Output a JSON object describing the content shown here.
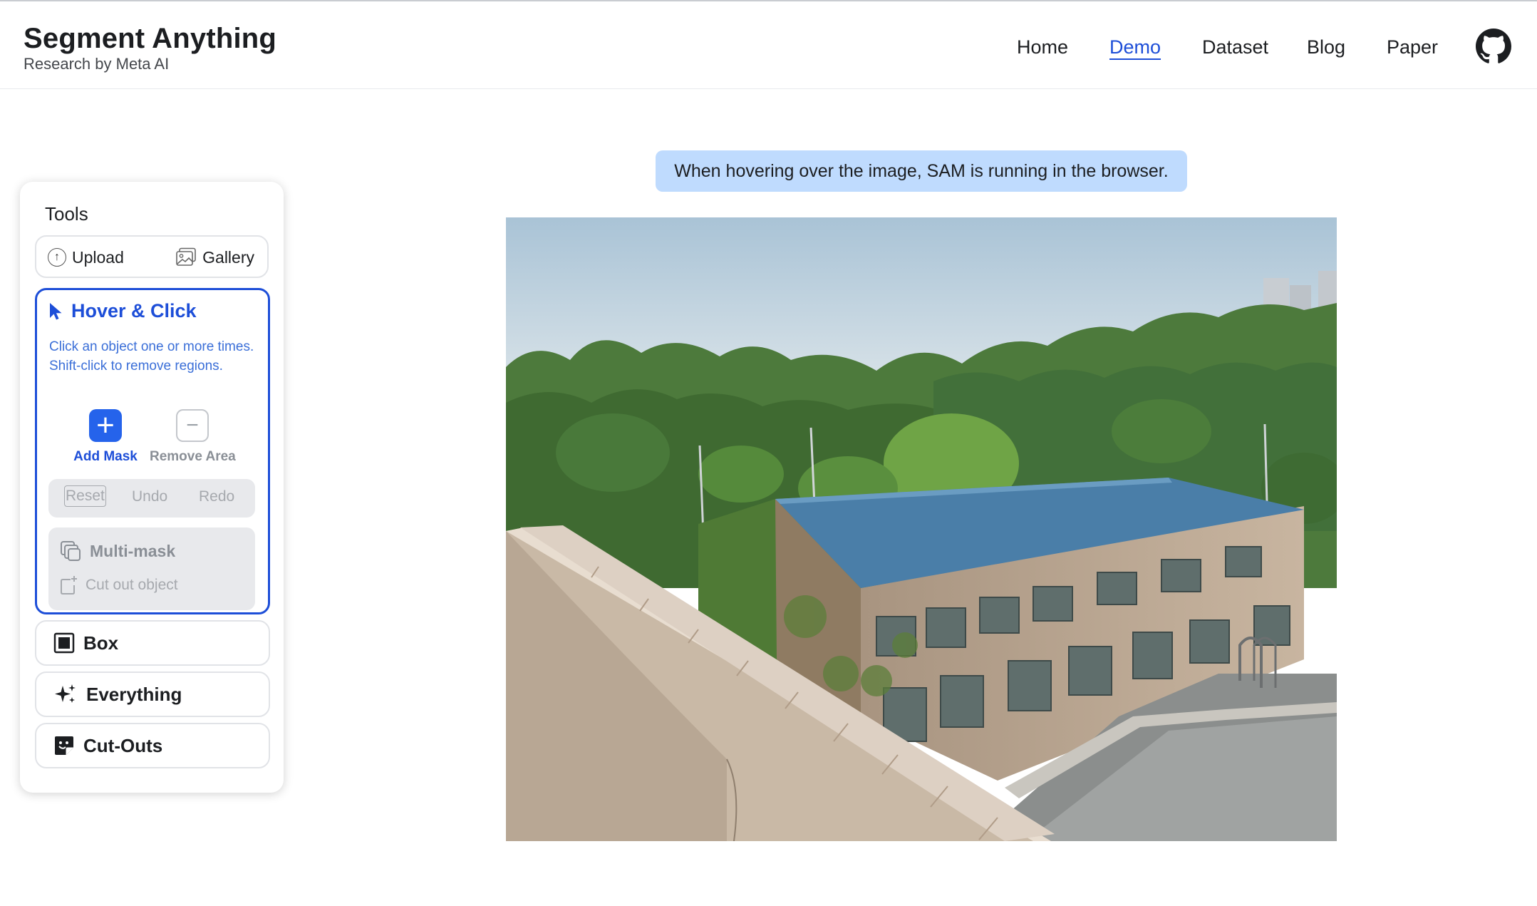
{
  "brand": {
    "title": "Segment Anything",
    "subtitle": "Research by Meta AI"
  },
  "nav": {
    "items": [
      {
        "label": "Home"
      },
      {
        "label": "Demo",
        "active": true
      },
      {
        "label": "Dataset"
      },
      {
        "label": "Blog"
      },
      {
        "label": "Paper"
      }
    ],
    "github_icon": "github-icon"
  },
  "tools": {
    "title": "Tools",
    "upload_label": "Upload",
    "gallery_label": "Gallery",
    "hover_click": {
      "title": "Hover & Click",
      "description": "Click an object one or more times. Shift-click to remove regions.",
      "add_mask_label": "Add Mask",
      "remove_area_label": "Remove Area",
      "reset_label": "Reset",
      "undo_label": "Undo",
      "redo_label": "Redo",
      "multimask_label": "Multi-mask",
      "cutout_label": "Cut out object"
    },
    "box_label": "Box",
    "everything_label": "Everything",
    "cutouts_label": "Cut-Outs"
  },
  "main": {
    "banner_text": "When hovering over the image, SAM is running in the browser."
  },
  "colors": {
    "accent": "#1d4ed8",
    "accent_fill": "#2563eb",
    "banner_bg": "#bfdbfe",
    "disabled_bg": "#e8e9ec",
    "roof_blue": "#4a7ea8"
  }
}
